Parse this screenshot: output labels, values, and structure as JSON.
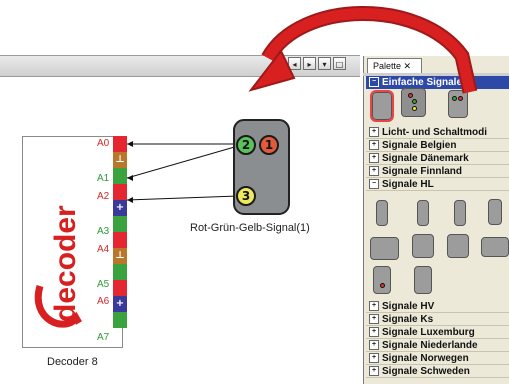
{
  "toolbar": {
    "nav_prev": "◂",
    "nav_next": "▸",
    "nav_menu": "▾",
    "nav_restore": "□"
  },
  "palette": {
    "tab_label": "Palette ✕",
    "sections": [
      {
        "label": "Einfache Signale",
        "expanded": true,
        "selected": true
      },
      {
        "label": "Licht- und Schaltmodi",
        "expanded": false
      },
      {
        "label": "Signale Belgien",
        "expanded": false
      },
      {
        "label": "Signale Dänemark",
        "expanded": false
      },
      {
        "label": "Signale Finnland",
        "expanded": false
      },
      {
        "label": "Signale HL",
        "expanded": true
      },
      {
        "label": "Signale HV",
        "expanded": false
      },
      {
        "label": "Signale Ks",
        "expanded": false
      },
      {
        "label": "Signale Luxemburg",
        "expanded": false
      },
      {
        "label": "Signale Niederlande",
        "expanded": false
      },
      {
        "label": "Signale Norwegen",
        "expanded": false
      },
      {
        "label": "Signale Schweden",
        "expanded": false
      }
    ]
  },
  "decoder": {
    "brand": "decoder",
    "caption": "Decoder 8",
    "pins": [
      {
        "label": "A0",
        "color": "#e3262f",
        "type": "red"
      },
      {
        "label": "",
        "color": "#b8772a",
        "type": "orange",
        "glyph": "⊥"
      },
      {
        "label": "A1",
        "color": "#3aa33f",
        "type": "green"
      },
      {
        "label": "A2",
        "color": "#e3262f",
        "type": "red"
      },
      {
        "label": "",
        "color": "#38399a",
        "type": "blue",
        "glyph": "+"
      },
      {
        "label": "A3",
        "color": "#3aa33f",
        "type": "green"
      },
      {
        "label": "A4",
        "color": "#e3262f",
        "type": "red"
      },
      {
        "label": "",
        "color": "#b8772a",
        "type": "orange",
        "glyph": "⊥"
      },
      {
        "label": "A5",
        "color": "#3aa33f",
        "type": "green"
      },
      {
        "label": "A6",
        "color": "#e3262f",
        "type": "red"
      },
      {
        "label": "",
        "color": "#38399a",
        "type": "blue",
        "glyph": "+"
      },
      {
        "label": "A7",
        "color": "#3aa33f",
        "type": "green"
      }
    ]
  },
  "signal": {
    "caption": "Rot-Grün-Gelb-Signal(1)",
    "lamps": {
      "green": "2",
      "red": "1",
      "yellow": "3"
    }
  },
  "colors": {
    "arrow_red": "#d7201f",
    "palette_header": "#2e48a8",
    "palette_bg": "#ece9d8"
  }
}
